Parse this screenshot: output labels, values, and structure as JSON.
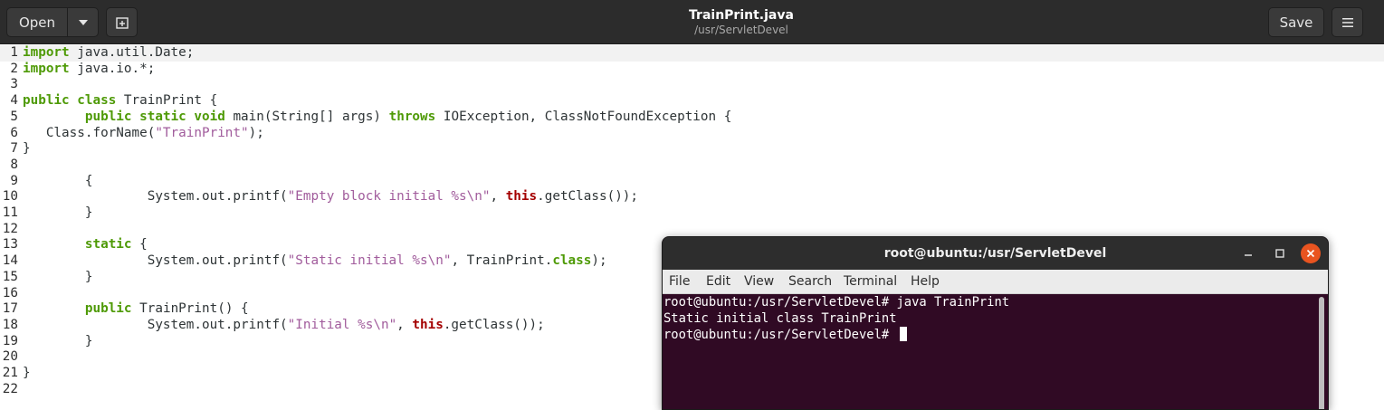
{
  "header": {
    "open_label": "Open",
    "title": "TrainPrint.java",
    "subtitle": "/usr/ServletDevel",
    "save_label": "Save",
    "icons": [
      "chevron-down-icon",
      "new-tab-icon",
      "hamburger-menu-icon"
    ]
  },
  "editor": {
    "lines": [
      {
        "n": "1",
        "code": "import java.util.Date;"
      },
      {
        "n": "2",
        "code": "import java.io.*;"
      },
      {
        "n": "3",
        "code": ""
      },
      {
        "n": "4",
        "code": "public class TrainPrint {"
      },
      {
        "n": "5",
        "code": "        public static void main(String[] args) throws IOException, ClassNotFoundException {"
      },
      {
        "n": "6",
        "code": "   Class.forName(\"TrainPrint\");"
      },
      {
        "n": "7",
        "code": "}"
      },
      {
        "n": "8",
        "code": ""
      },
      {
        "n": "9",
        "code": "        {"
      },
      {
        "n": "10",
        "code": "                System.out.printf(\"Empty block initial %s\\n\", this.getClass());"
      },
      {
        "n": "11",
        "code": "        }"
      },
      {
        "n": "12",
        "code": ""
      },
      {
        "n": "13",
        "code": "        static {"
      },
      {
        "n": "14",
        "code": "                System.out.printf(\"Static initial %s\\n\", TrainPrint.class);"
      },
      {
        "n": "15",
        "code": "        }"
      },
      {
        "n": "16",
        "code": ""
      },
      {
        "n": "17",
        "code": "        public TrainPrint() {"
      },
      {
        "n": "18",
        "code": "                System.out.printf(\"Initial %s\\n\", this.getClass());"
      },
      {
        "n": "19",
        "code": "        }"
      },
      {
        "n": "20",
        "code": ""
      },
      {
        "n": "21",
        "code": "}"
      },
      {
        "n": "22",
        "code": ""
      }
    ]
  },
  "terminal": {
    "title": "root@ubuntu:/usr/ServletDevel",
    "menu": [
      "File",
      "Edit",
      "View",
      "Search",
      "Terminal",
      "Help"
    ],
    "lines": [
      "root@ubuntu:/usr/ServletDevel# java TrainPrint",
      "Static initial class TrainPrint",
      "root@ubuntu:/usr/ServletDevel# "
    ],
    "icons": [
      "minimize-icon",
      "maximize-icon",
      "close-icon"
    ]
  },
  "colors": {
    "keyword": "#4e9a06",
    "this_keyword": "#a40000",
    "string": "#a15c9c",
    "terminal_bg": "#300a24",
    "close_button": "#e95420"
  }
}
